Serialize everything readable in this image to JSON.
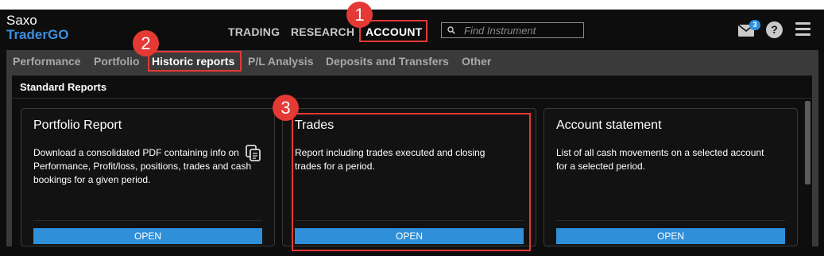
{
  "brand": {
    "line1": "Saxo",
    "line2": "TraderGO"
  },
  "topnav": {
    "trading": "TRADING",
    "research": "RESEARCH",
    "account": "ACCOUNT"
  },
  "search": {
    "placeholder": "Find Instrument"
  },
  "header": {
    "mail_badge": "3",
    "help_glyph": "?"
  },
  "subnav": {
    "items": [
      {
        "label": "Performance"
      },
      {
        "label": "Portfolio"
      },
      {
        "label": "Historic reports",
        "active": true
      },
      {
        "label": "P/L Analysis"
      },
      {
        "label": "Deposits and Transfers"
      },
      {
        "label": "Other"
      }
    ]
  },
  "panel": {
    "title": "Standard Reports"
  },
  "reports": [
    {
      "title": "Portfolio Report",
      "description": "Download a consolidated PDF containing info on Performance, Profit/loss, positions, trades and cash bookings for a given period.",
      "button": "OPEN"
    },
    {
      "title": "Trades",
      "description": "Report including trades executed and closing trades for a period.",
      "button": "OPEN"
    },
    {
      "title": "Account statement",
      "description": "List of all cash movements on a selected account for a selected period.",
      "button": "OPEN"
    }
  ],
  "steps": [
    "1",
    "2",
    "3"
  ],
  "colors": {
    "accent": "#2f8fd8",
    "highlight": "#e53935",
    "brand_blue": "#3d8fe0",
    "background": "#0d0d0d"
  },
  "icons": [
    "search-icon",
    "mail-icon",
    "help-icon",
    "menu-icon",
    "copy-icon"
  ]
}
